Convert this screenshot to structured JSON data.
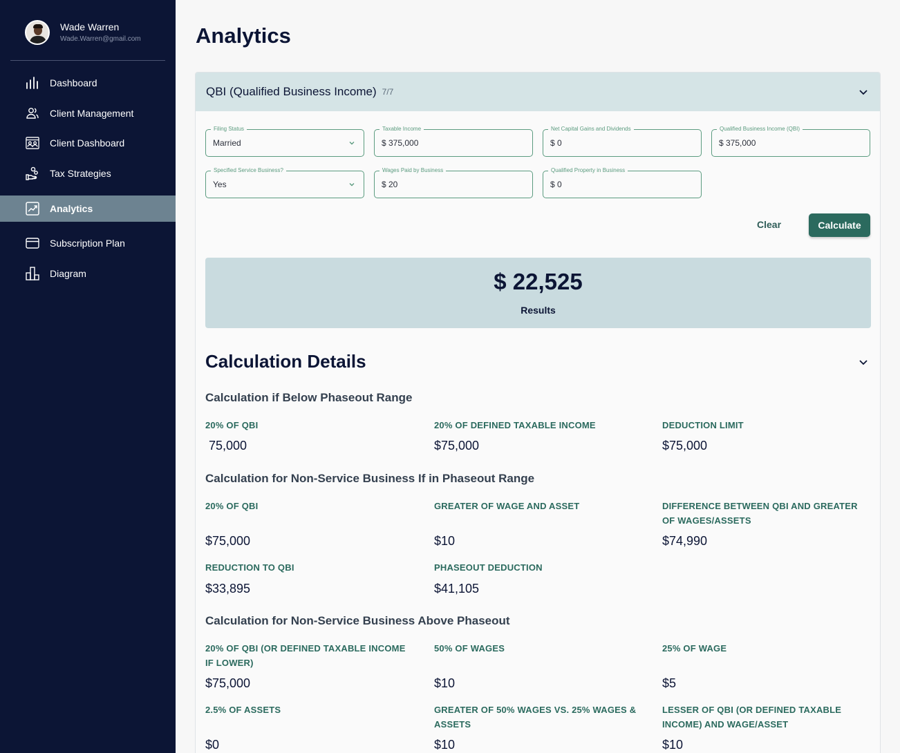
{
  "user": {
    "name": "Wade Warren",
    "email": "Wade.Warren@gmail.com"
  },
  "nav": {
    "dashboard": "Dashboard",
    "client_management": "Client Management",
    "client_dashboard": "Client Dashboard",
    "tax_strategies": "Tax Strategies",
    "analytics": "Analytics",
    "subscription_plan": "Subscription Plan",
    "diagram": "Diagram"
  },
  "page": {
    "title": "Analytics"
  },
  "qbi": {
    "title": "QBI (Qualified Business Income)",
    "step": "7/7",
    "fields": {
      "filing_status": {
        "label": "Filing Status",
        "value": "Married"
      },
      "taxable_income": {
        "label": "Taxable Income",
        "value": "$ 375,000"
      },
      "net_capital_gains": {
        "label": "Net Capital Gains and Dividends",
        "value": "$ 0"
      },
      "qbi": {
        "label": "Qualified Business Income (QBI)",
        "value": "$ 375,000"
      },
      "specified_service": {
        "label": "Specified Service Business?",
        "value": "Yes"
      },
      "wages": {
        "label": "Wages Paid by Business",
        "value": "$ 20"
      },
      "property": {
        "label": "Qualified Property in Business",
        "value": "$ 0"
      }
    },
    "clear_label": "Clear",
    "calculate_label": "Calculate",
    "result_value": "$ 22,525",
    "result_label": "Results"
  },
  "details": {
    "title": "Calculation Details",
    "below": {
      "title": "Calculation if Below Phaseout Range",
      "items": [
        {
          "label": "20% OF QBI",
          "value": "75,000"
        },
        {
          "label": "20% OF DEFINED TAXABLE INCOME",
          "value": "$75,000"
        },
        {
          "label": "DEDUCTION LIMIT",
          "value": "$75,000"
        }
      ]
    },
    "in_phaseout": {
      "title": "Calculation for Non-Service Business If in Phaseout Range",
      "items": [
        {
          "label": "20% OF QBI",
          "value": "$75,000"
        },
        {
          "label": "GREATER OF WAGE AND ASSET",
          "value": "$10"
        },
        {
          "label": "DIFFERENCE BETWEEN QBI AND GREATER OF WAGES/ASSETS",
          "value": "$74,990"
        },
        {
          "label": "REDUCTION TO QBI",
          "value": "$33,895"
        },
        {
          "label": "PHASEOUT DEDUCTION",
          "value": "$41,105"
        }
      ]
    },
    "above": {
      "title": "Calculation for Non-Service Business Above Phaseout",
      "items": [
        {
          "label": "20% OF QBI (OR DEFINED TAXABLE INCOME IF LOWER)",
          "value": "$75,000"
        },
        {
          "label": "50% OF WAGES",
          "value": "$10"
        },
        {
          "label": "25% OF WAGE",
          "value": "$5"
        },
        {
          "label": "2.5% OF ASSETS",
          "value": "$0"
        },
        {
          "label": "GREATER OF 50% WAGES VS. 25% WAGES & ASSETS",
          "value": "$10"
        },
        {
          "label": "LESSER OF QBI (OR DEFINED TAXABLE INCOME) AND WAGE/ASSET",
          "value": "$10"
        }
      ]
    }
  },
  "colors": {
    "sidebar": "#0c1535",
    "accent": "#2b6a5e",
    "active_nav": "#6d8391"
  }
}
